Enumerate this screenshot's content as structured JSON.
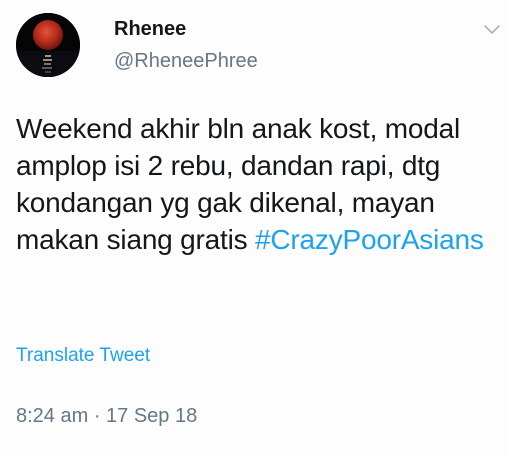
{
  "tweet": {
    "author": {
      "display_name": "Rhenee",
      "handle": "@RheneePhree"
    },
    "avatar_icon": "blood-moon-over-sea-avatar",
    "menu_icon": "chevron-down-icon",
    "body_text": "Weekend akhir bln anak kost, modal amplop isi 2 rebu, dandan rapi, dtg kondangan yg gak dikenal, mayan makan siang gratis ",
    "hashtag": "#CrazyPoorAsians",
    "translate_label": "Translate Tweet",
    "timestamp": "8:24 am · 17 Sep 18"
  },
  "colors": {
    "text": "#14171a",
    "secondary_text": "#657786",
    "link": "#1da1f2",
    "background": "#fdfdfd"
  }
}
